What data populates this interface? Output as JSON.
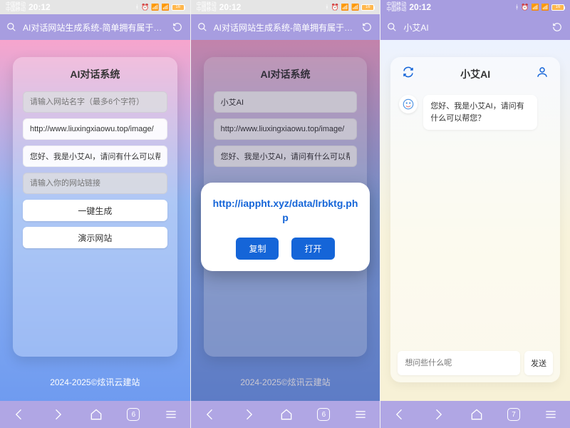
{
  "status": {
    "carrier": "中国移动",
    "time": "20:12",
    "battery": "16"
  },
  "screens": [
    {
      "browser_title": "AI对话网站生成系统-简单拥有属于自…",
      "card_title": "AI对话系统",
      "fields": {
        "name_placeholder": "请输入网站名字（最多6个字符）",
        "avatar_value": "http://www.liuxingxiaowu.top/image/",
        "greeting_value": "您好、我是小艾AI，请问有什么可以帮您",
        "link_placeholder": "请输入你的网站链接"
      },
      "buttons": {
        "generate": "一键生成",
        "demo": "演示网站"
      },
      "footer": "2024-2025©炫讯云建站",
      "tab_count": "6"
    },
    {
      "browser_title": "AI对话网站生成系统-简单拥有属于自…",
      "card_title": "AI对话系统",
      "fields": {
        "name_value": "小艾AI",
        "avatar_value": "http://www.liuxingxiaowu.top/image/",
        "greeting_value": "您好、我是小艾AI，请问有什么可以帮您"
      },
      "modal": {
        "url": "http://iappht.xyz/data/lrbktg.php",
        "copy": "复制",
        "open": "打开"
      },
      "footer": "2024-2025©炫讯云建站",
      "tab_count": "6"
    },
    {
      "browser_title": "小艾AI",
      "chat_title": "小艾AI",
      "greeting_msg": "您好、我是小艾AI，请问有什么可以帮您？",
      "input_placeholder": "想问些什么呢",
      "send_label": "发送",
      "tab_count": "7"
    }
  ]
}
